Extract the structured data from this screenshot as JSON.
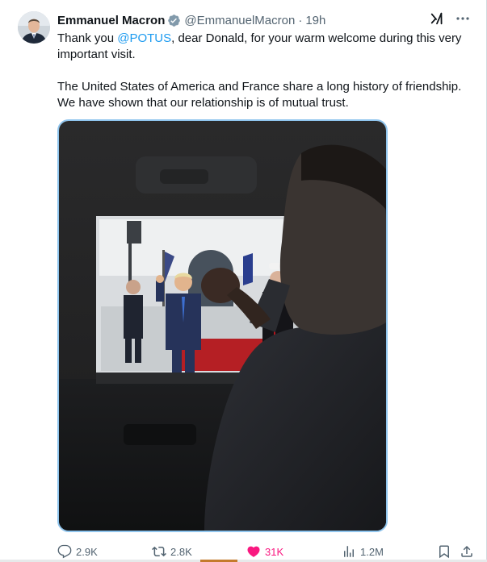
{
  "author": {
    "display_name": "Emmanuel Macron",
    "handle": "@EmmanuelMacron",
    "separator": "·",
    "time": "19h",
    "verified": true
  },
  "body": {
    "line1_pre": "Thank you ",
    "mention": "@POTUS",
    "line1_post": ", dear Donald, for your warm welcome during this very important visit.",
    "paragraph2": "The United States of America and France share a long history of friendship. We have shown that our relationship is of mutual trust."
  },
  "icons": {
    "verified": "verified-badge-icon",
    "grok": "grok-icon",
    "more": "more-icon",
    "reply": "reply-icon",
    "retweet": "retweet-icon",
    "like": "heart-icon",
    "views": "views-icon",
    "bookmark": "bookmark-icon",
    "share": "share-icon"
  },
  "stats": {
    "replies": "2.9K",
    "retweets": "2.8K",
    "likes": "31K",
    "views": "1.2M"
  },
  "colors": {
    "accent": "#1d9bf0",
    "like": "#f91880",
    "muted": "#536471",
    "media_border": "#8fc5ee"
  }
}
